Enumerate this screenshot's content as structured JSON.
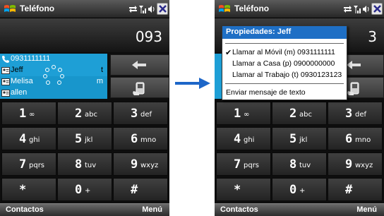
{
  "left_phone": {
    "app_title": "Teléfono",
    "number": "093",
    "matches": [
      {
        "text": "0931111111",
        "hint": ""
      },
      {
        "text": "Jeff",
        "hint": "t"
      },
      {
        "text": "Melisa",
        "hint": "m"
      },
      {
        "text": "allen",
        "hint": ""
      }
    ]
  },
  "right_phone": {
    "app_title": "Teléfono",
    "number": "3",
    "menu": {
      "header": "Propiedades: Jeff",
      "items": [
        {
          "label": "Llamar al Móvil (m) 0931111111",
          "checked": true
        },
        {
          "label": "Llamar a Casa (p) 0900000000",
          "checked": false
        },
        {
          "label": "Llamar al Trabajo (t) 0930123123",
          "checked": false
        }
      ],
      "sms": "Enviar mensaje de texto",
      "check_symbol": "✔"
    }
  },
  "keypad": [
    {
      "digit": "1",
      "letters": "∞"
    },
    {
      "digit": "2",
      "letters": "abc"
    },
    {
      "digit": "3",
      "letters": "def"
    },
    {
      "digit": "4",
      "letters": "ghi"
    },
    {
      "digit": "5",
      "letters": "jkl"
    },
    {
      "digit": "6",
      "letters": "mno"
    },
    {
      "digit": "7",
      "letters": "pqrs"
    },
    {
      "digit": "8",
      "letters": "tuv"
    },
    {
      "digit": "9",
      "letters": "wxyz"
    },
    {
      "digit": "*",
      "letters": ""
    },
    {
      "digit": "0",
      "letters": "+"
    },
    {
      "digit": "#",
      "letters": ""
    }
  ],
  "softkeys": {
    "left": "Contactos",
    "right": "Menú"
  },
  "colors": {
    "match_highlight": "#1e9fd6",
    "menu_header": "#1e6fc5",
    "arrow": "#1d66c8"
  }
}
